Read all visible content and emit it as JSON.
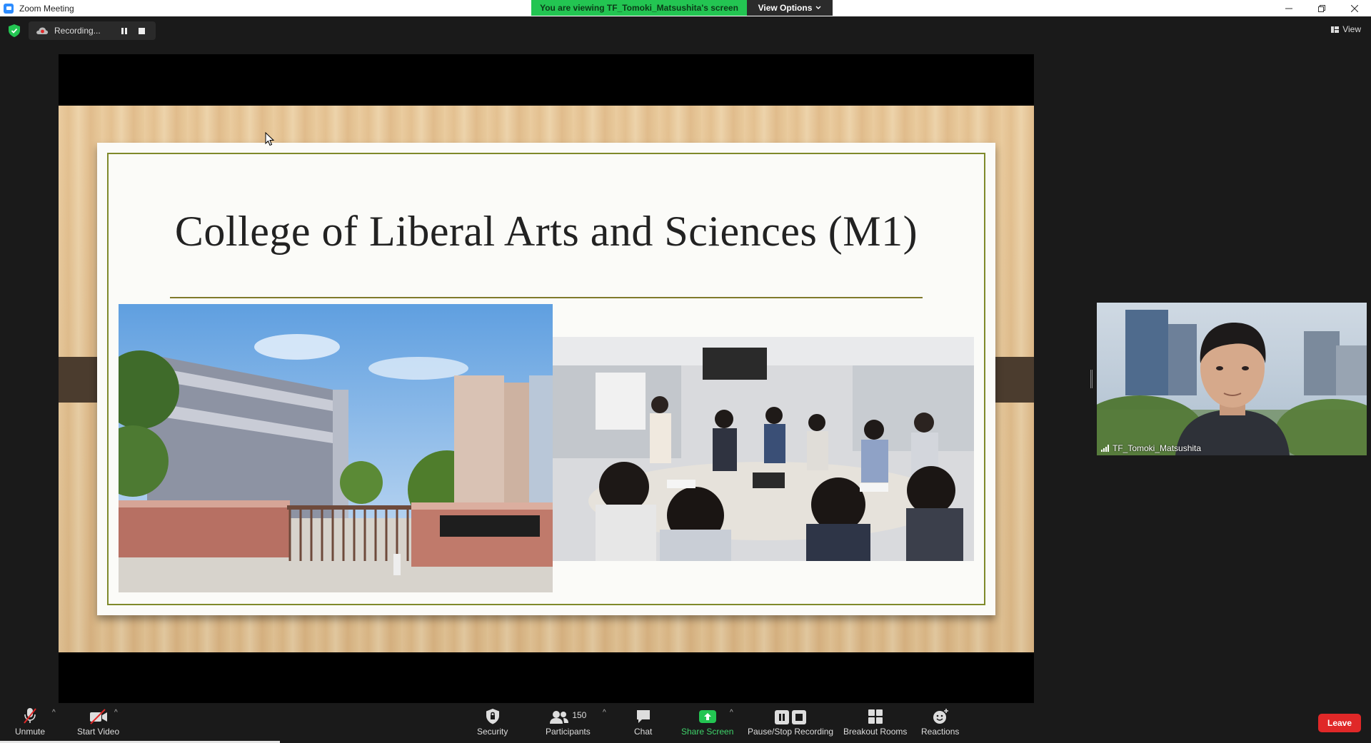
{
  "window": {
    "title": "Zoom Meeting"
  },
  "banner": {
    "viewing_text": "You are viewing TF_Tomoki_Matsushita's screen",
    "view_options_label": "View Options"
  },
  "recording": {
    "status_text": "Recording..."
  },
  "top_right": {
    "view_label": "View"
  },
  "slide": {
    "title": "College of Liberal Arts and Sciences (M1)"
  },
  "participant": {
    "name": "TF_Tomoki_Matsushita"
  },
  "toolbar": {
    "unmute": "Unmute",
    "start_video": "Start Video",
    "security": "Security",
    "participants": "Participants",
    "participants_count": "150",
    "chat": "Chat",
    "share_screen": "Share Screen",
    "pause_stop_recording": "Pause/Stop Recording",
    "breakout_rooms": "Breakout Rooms",
    "reactions": "Reactions",
    "leave": "Leave"
  },
  "colors": {
    "share_green": "#23c552",
    "leave_red": "#e02828",
    "toolbar_bg": "#1a1a1a"
  }
}
